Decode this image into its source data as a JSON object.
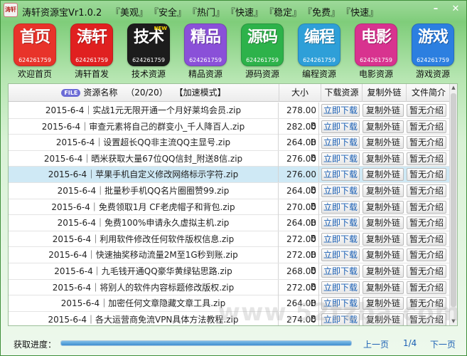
{
  "app": {
    "logo_text": "涛轩",
    "title": "涛轩资源宝Vr1.0.2",
    "menu": [
      "『美观』",
      "『安全』",
      "『热门』",
      "『快速』",
      "『稳定』",
      "『免费』",
      "『快速』"
    ],
    "window_controls": {
      "minimize": "–",
      "close": "✕"
    }
  },
  "tiles": [
    {
      "big": "首页",
      "qq": "624261759",
      "label": "欢迎首页",
      "color": "#e8332a"
    },
    {
      "big": "涛轩",
      "qq": "624261759",
      "label": "涛轩首发",
      "color": "#e02020"
    },
    {
      "big": "技术",
      "qq": "624261759",
      "label": "技术资源",
      "color": "#1c1c1c",
      "tag": "NEW"
    },
    {
      "big": "精品",
      "qq": "624261759",
      "label": "精品资源",
      "color": "#8a50d8"
    },
    {
      "big": "源码",
      "qq": "624261759",
      "label": "源码资源",
      "color": "#2db24a"
    },
    {
      "big": "编程",
      "qq": "624261759",
      "label": "编程资源",
      "color": "#2e9fd8"
    },
    {
      "big": "电影",
      "qq": "624261759",
      "label": "电影资源",
      "color": "#d8338f"
    },
    {
      "big": "游戏",
      "qq": "624261759",
      "label": "游戏资源",
      "color": "#2c7fe0"
    }
  ],
  "table": {
    "file_badge": "FILE",
    "header_name": "资源名称",
    "header_count": "（20/20）",
    "header_mode": "【加速模式】",
    "header_size": "大小",
    "header_download": "下载资源",
    "header_copy": "复制外链",
    "header_intro": "文件简介",
    "download_label": "立即下载",
    "copy_label": "复制外链",
    "intro_label": "暂无介绍",
    "selected_row": 4,
    "rows": [
      {
        "name": "2015-6-4｜实战1元无限开通一个月好莱坞会员.zip",
        "size": "278.00 B"
      },
      {
        "name": "2015-6-4｜审查元素将自己的群变小_千人降百人.zip",
        "size": "282.00 B"
      },
      {
        "name": "2015-6-4｜设置超长QQ非主流QQ主显号.zip",
        "size": "264.00 B"
      },
      {
        "name": "2015-6-4｜晒米获取大量67位QQ信封_附送8信.zip",
        "size": "276.00 B"
      },
      {
        "name": "2015-6-4｜苹果手机自定义修改网络标示字符.zip",
        "size": "276.00 B"
      },
      {
        "name": "2015-6-4｜批量秒手机QQ名片圈圈赞99.zip",
        "size": "264.00 B"
      },
      {
        "name": "2015-6-4｜免费领取1月 CF老虎帽子和背包.zip",
        "size": "270.00 B"
      },
      {
        "name": "2015-6-4｜免费100%申请永久虚拟主机.zip",
        "size": "264.00 B"
      },
      {
        "name": "2015-6-4｜利用软件修改任何软件版权信息.zip",
        "size": "272.00 B"
      },
      {
        "name": "2015-6-4｜快速抽奖移动流量2M至1G秒到账.zip",
        "size": "272.00 B"
      },
      {
        "name": "2015-6-4｜九毛钱开通QQ豪华黄绿钻思路.zip",
        "size": "268.00 B"
      },
      {
        "name": "2015-6-4｜将别人的软件内容标题修改版权.zip",
        "size": "272.00 B"
      },
      {
        "name": "2015-6-4｜加密任何文章隐藏文章工具.zip",
        "size": "264.00 B"
      },
      {
        "name": "2015-6-4｜各大运营商免流VPN具体方法教程.zip",
        "size": "274.00 B"
      }
    ]
  },
  "bottom": {
    "progress_label": "获取进度：",
    "progress": 1.0,
    "prev": "上一页",
    "page": "1/4",
    "next": "下一页",
    "watermark": "www.52tzba.com"
  }
}
